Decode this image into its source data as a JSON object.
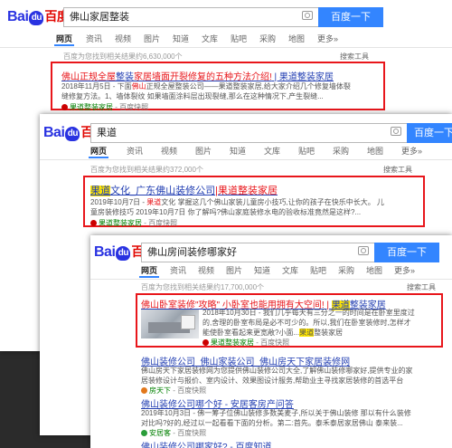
{
  "logo": {
    "bai": "Bai",
    "du": "du",
    "zh": "百度"
  },
  "tabs": [
    "网页",
    "资讯",
    "视频",
    "图片",
    "知道",
    "文库",
    "贴吧",
    "采购",
    "地图",
    "更多»"
  ],
  "search_tools": "搜索工具",
  "search_button": "百度一下",
  "icons": {
    "camera": "camera-icon",
    "source": "baidu-source-icon"
  },
  "colors": {
    "accent": "#3385ff",
    "highlight_box": "#e8161b",
    "link": "#2440b3",
    "url": "#008000"
  },
  "panel1": {
    "query": "佛山家居整装",
    "count": "百度为您找到相关结果约6,630,000个",
    "result": {
      "title_a": "佛山正规全屋",
      "title_em1": "整装",
      "title_b": "家居墙面开裂修复的五种方法介绍!",
      "title_c": " | 果道整装家居",
      "desc1": "2018年11月5日 - 下面",
      "desc1_em": "佛山",
      "desc1_b": "正规全屋整装公司——果道整装家居,给大家介绍几个修复墙体裂",
      "desc2": "缝修复方法。1、墙体裂纹 如果墙面涂料层出现裂缝,那么在这种情况下,产生裂缝...",
      "src": "果道整装家居",
      "kz": " - 百度快照"
    }
  },
  "panel2": {
    "query": "果道",
    "count": "百度为您找到相关结果约372,000个",
    "result": {
      "title_hl": "果道",
      "title_a": "文化_广东佛山装修公司",
      "title_b": "|果道整装家居",
      "desc1": "2019年10月7日 - ",
      "desc1_em": "果道",
      "desc1_b": "文化 掌握这几个佛山家装儿童房小技巧,让你的孩子在快乐中长大。 儿",
      "desc2": "童房装修技巧 2019年10月7日 你了解吗?佛山家庭装修水电的验收标准竟然是这样?...",
      "src": "果道整装家居",
      "kz": " - 百度快照"
    }
  },
  "panel3": {
    "query": "佛山房间装修哪家好",
    "count": "百度为您找到相关结果约17,700,000个",
    "result1": {
      "title_a": "佛山卧室装修\"攻略\" 小卧室也能用拥有大空间! | ",
      "title_hl": "果道",
      "title_b": "整装家居",
      "d1": "2018年10月30日 - 我们几乎每天有三分之一的时间是在卧室里度过",
      "d2": "的,舍理的卧室布局是必不可少的。所以,我们在卧室装修时,怎样才",
      "d3": "能使卧室看起来更宽敞?小面...",
      "d3_hl": "果道",
      "d3_b": "整装家居",
      "src": "果道整装家居",
      "kz": " - 百度快照"
    },
    "result2": {
      "title": "佛山装修公司_佛山家装公司_佛山房天下家居装修网",
      "d1": "佛山房天下家居装修网为您提供佛山装修公司大全,了解佛山装修哪家好,提供专业的家",
      "d2": "居装修设计与报价、室内设计、效果图设计服务,帮助业主寻找家居装修的首选平台",
      "src": "房天下",
      "kz": " - 百度快照"
    },
    "result3": {
      "title": "佛山装修公司哪个好 - 安居客房产问答",
      "d1": "2019年10月3日 - 佛一筹子位佛山装修多数美麦子,所以关于佛山装修 那以有什么装修",
      "d2": "对比吗?好的,经过以一起看看下面的分析。第二:首先。泰禾泰居家居佛山 泰来装...",
      "src": "安居客",
      "kz": " - 百度快照"
    },
    "result4": {
      "title": "佛山装修公司哪家好? - 百度知道"
    }
  }
}
